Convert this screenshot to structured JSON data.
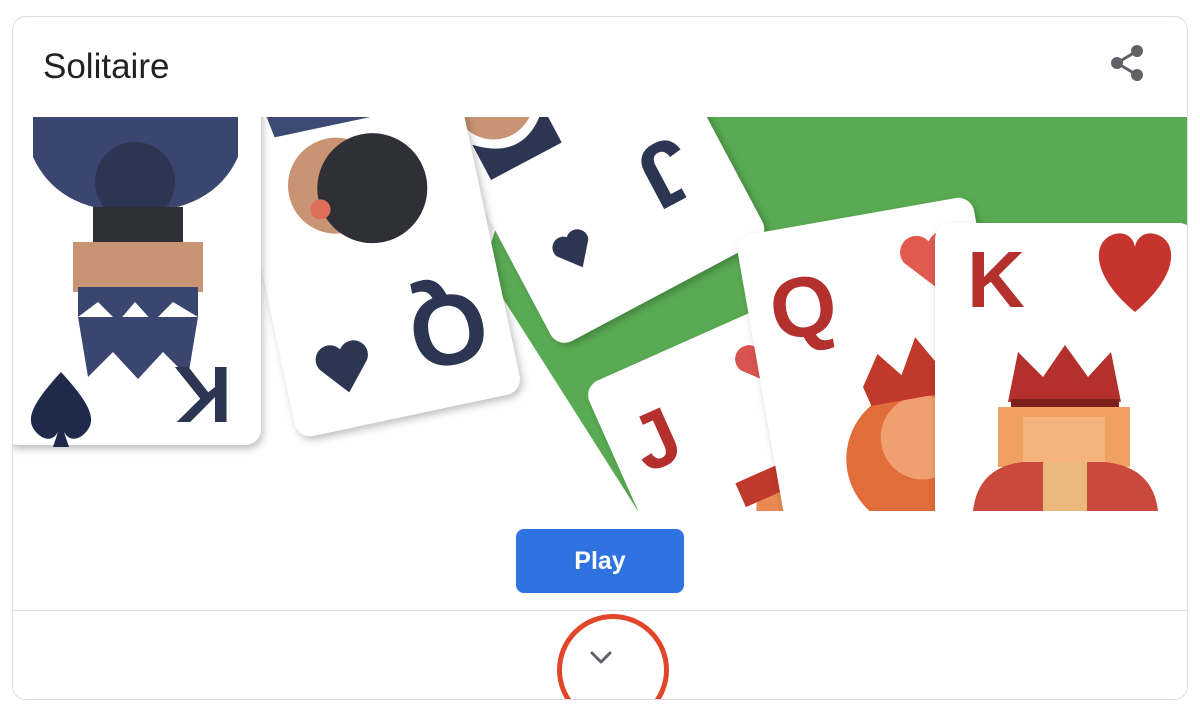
{
  "card": {
    "title": "Solitaire",
    "share_icon": "share-icon",
    "play_label": "Play",
    "expand_icon": "chevron-down-icon"
  },
  "hero": {
    "background": "#59ab53",
    "cards": [
      {
        "rank": "K",
        "suit": "spade",
        "color": "#1f2a4a"
      },
      {
        "rank": "Q",
        "suit": "spade",
        "color": "#1f2a4a"
      },
      {
        "rank": "J",
        "suit": "spade",
        "color": "#1f2a4a"
      },
      {
        "rank": "J",
        "suit": "heart",
        "color": "#b3302d"
      },
      {
        "rank": "Q",
        "suit": "heart",
        "color": "#b3302d"
      },
      {
        "rank": "K",
        "suit": "heart",
        "color": "#b3302d"
      }
    ]
  },
  "colors": {
    "play_button": "#2f73e0",
    "highlight_ring": "#e2462a",
    "border": "#dadce0"
  }
}
